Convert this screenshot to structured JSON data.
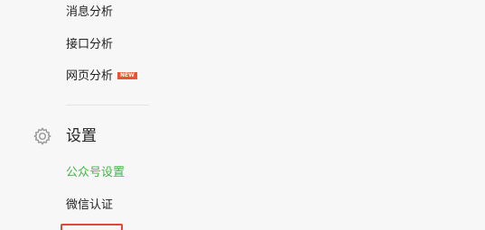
{
  "sidebar": {
    "stats_items": [
      {
        "label": "消息分析"
      },
      {
        "label": "接口分析"
      },
      {
        "label": "网页分析",
        "badge": "NEW"
      }
    ],
    "settings_section": {
      "title": "设置",
      "icon": "gear-icon",
      "items": [
        {
          "label": "公众号设置",
          "active": true
        },
        {
          "label": "微信认证"
        }
      ]
    }
  },
  "colors": {
    "active_text": "#44b549",
    "badge_bg": "#e9532d",
    "highlight_border": "#e2463c"
  }
}
